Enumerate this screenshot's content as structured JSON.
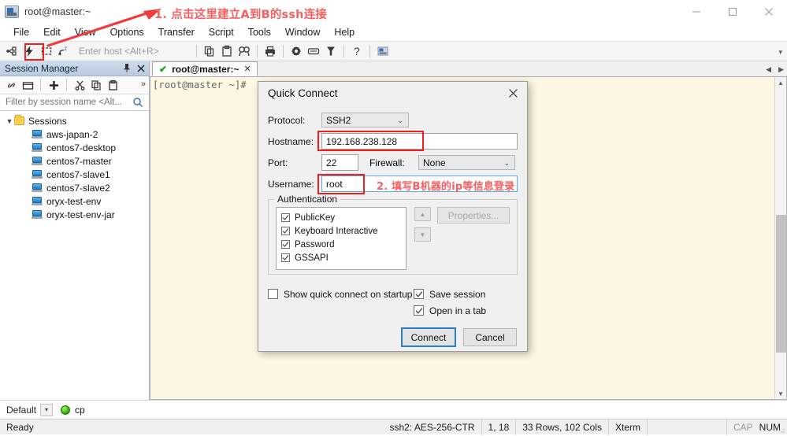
{
  "window": {
    "title": "root@master:~",
    "icon": "terminal-window-icon",
    "controls": {
      "minimize": "minimize-icon",
      "maximize": "maximize-icon",
      "close": "close-icon"
    }
  },
  "menubar": {
    "items": [
      "File",
      "Edit",
      "View",
      "Options",
      "Transfer",
      "Script",
      "Tools",
      "Window",
      "Help"
    ]
  },
  "toolbar": {
    "host_placeholder": "Enter host <Alt+R>",
    "icons": [
      "connect-icon",
      "quick-connect-icon",
      "reconnect-icon",
      "disconnect-icon"
    ],
    "icons_right": [
      "copy-icon",
      "paste-icon",
      "find-icon",
      "print-icon",
      "settings-icon",
      "keymap-icon",
      "filter-icon",
      "help-icon",
      "session-options-icon"
    ],
    "overflow": "chevron-down-icon"
  },
  "session_manager": {
    "title": "Session Manager",
    "pin_icon": "pin-icon",
    "close_icon": "close-icon",
    "toolbar_icons": [
      "link-icon",
      "new-folder-icon",
      "add-icon",
      "cut-icon",
      "copy-icon",
      "paste-icon"
    ],
    "overflow": "chevron-right-icon",
    "filter_placeholder": "Filter by session name <Alt...",
    "filter_value": "",
    "search_icon": "search-icon",
    "root_label": "Sessions",
    "sessions": [
      "aws-japan-2",
      "centos7-desktop",
      "centos7-master",
      "centos7-slave1",
      "centos7-slave2",
      "oryx-test-env",
      "oryx-test-env-jar"
    ]
  },
  "tabs": [
    {
      "label": "root@master:~",
      "status_icon": "check-icon",
      "close_icon": "close-icon"
    }
  ],
  "terminal": {
    "prompt_line": "[root@master ~]#",
    "background": "#fdf6e3"
  },
  "dialog": {
    "title": "Quick Connect",
    "close_icon": "close-icon",
    "fields": {
      "protocol_label": "Protocol:",
      "protocol_value": "SSH2",
      "hostname_label": "Hostname:",
      "hostname_value": "192.168.238.128",
      "port_label": "Port:",
      "port_value": "22",
      "firewall_label": "Firewall:",
      "firewall_value": "None",
      "username_label": "Username:",
      "username_value": "root"
    },
    "authentication": {
      "legend": "Authentication",
      "items": [
        {
          "label": "PublicKey",
          "checked": true
        },
        {
          "label": "Keyboard Interactive",
          "checked": true
        },
        {
          "label": "Password",
          "checked": true
        },
        {
          "label": "GSSAPI",
          "checked": true
        }
      ],
      "properties_button": "Properties...",
      "up_icon": "arrow-up-icon",
      "down_icon": "arrow-down-icon"
    },
    "options": [
      {
        "label": "Show quick connect on startup",
        "checked": false
      },
      {
        "label": "Save session",
        "checked": true
      },
      {
        "label": "Open in a tab",
        "checked": true
      }
    ],
    "buttons": {
      "connect": "Connect",
      "cancel": "Cancel"
    }
  },
  "bottom_bar": {
    "profile": "Default",
    "profile_caret": "chevron-down-icon",
    "status_dot": "green-status-dot",
    "chat_label": "cp"
  },
  "statusbar": {
    "ready": "Ready",
    "cipher": "ssh2: AES-256-CTR",
    "cursor": "1, 18",
    "dimensions": "33 Rows, 102 Cols",
    "emulation": "Xterm",
    "caps": "CAP",
    "num": "NUM"
  },
  "annotations": {
    "step1": "1. 点击这里建立A到B的ssh连接",
    "step2": "2. 填写B机器的ip等信息登录",
    "color": "#f8605f"
  }
}
